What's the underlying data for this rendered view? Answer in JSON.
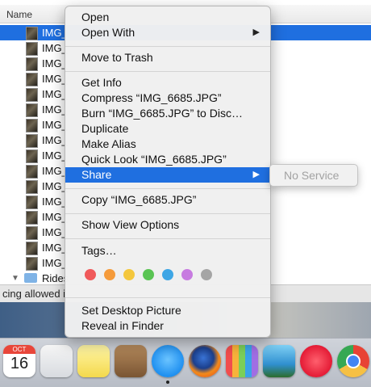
{
  "finder": {
    "column_header": "Name",
    "rows": [
      "IMG_",
      "IMG_",
      "IMG_",
      "IMG_",
      "IMG_",
      "IMG_",
      "IMG_",
      "IMG_",
      "IMG_",
      "IMG_",
      "IMG_",
      "IMG_",
      "IMG_",
      "IMG_",
      "IMG_",
      "IMG_"
    ],
    "folder_label": "Rides",
    "status_text": "cing allowed i"
  },
  "menu": {
    "open": "Open",
    "open_with": "Open With",
    "move_to_trash": "Move to Trash",
    "get_info": "Get Info",
    "compress": "Compress “IMG_6685.JPG”",
    "burn": "Burn “IMG_6685.JPG” to Disc…",
    "duplicate": "Duplicate",
    "make_alias": "Make Alias",
    "quick_look": "Quick Look “IMG_6685.JPG”",
    "share": "Share",
    "copy": "Copy “IMG_6685.JPG”",
    "show_view_options": "Show View Options",
    "tags": "Tags…",
    "set_desktop_picture": "Set Desktop Picture",
    "reveal_in_finder": "Reveal in Finder",
    "submenu_arrow": "▶"
  },
  "submenu": {
    "no_service": "No Service"
  },
  "tag_colors": [
    "#f0595a",
    "#f59b3b",
    "#f4c73d",
    "#5ac453",
    "#3ea6e5",
    "#c77be0",
    "#a5a5a5"
  ],
  "dock": {
    "calendar_month": "OCT",
    "calendar_day": "16"
  }
}
